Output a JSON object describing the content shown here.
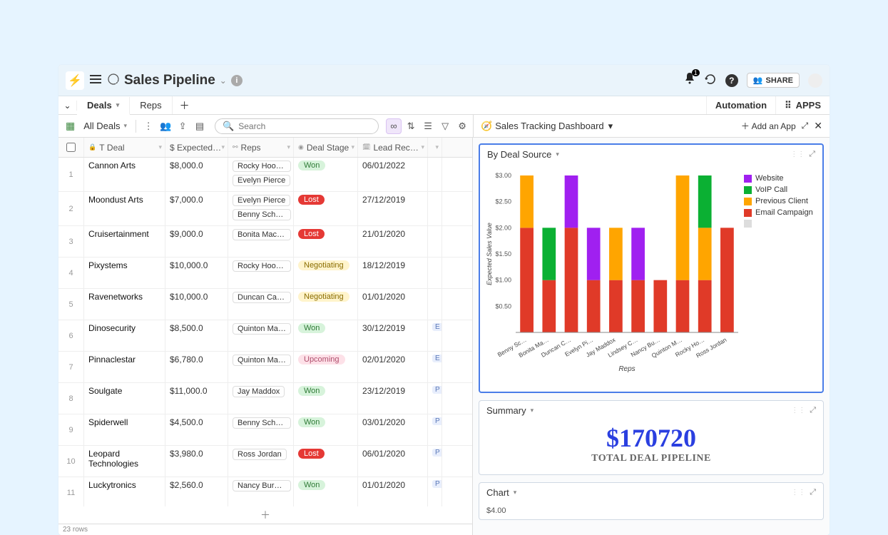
{
  "titlebar": {
    "title": "Sales Pipeline",
    "notifications": "1",
    "share": "SHARE"
  },
  "tabs": {
    "items": [
      "Deals",
      "Reps"
    ],
    "automation": "Automation",
    "apps": "APPS"
  },
  "toolbar": {
    "view_name": "All Deals",
    "search_placeholder": "Search"
  },
  "grid": {
    "headers": [
      "Deal",
      "Expected …",
      "Reps",
      "Deal Stage",
      "Lead Receive…"
    ],
    "rows": [
      {
        "n": "1",
        "deal": "Cannon Arts",
        "expected": "$8,000.0",
        "reps": [
          "Rocky Hooper",
          "Evelyn Pierce"
        ],
        "stage": "Won",
        "stage_cls": "won",
        "date": "06/01/2022",
        "src": ""
      },
      {
        "n": "2",
        "deal": "Moondust Arts",
        "expected": "$7,000.0",
        "reps": [
          "Evelyn Pierce",
          "Benny Schwartz"
        ],
        "stage": "Lost",
        "stage_cls": "lost",
        "date": "27/12/2019",
        "src": ""
      },
      {
        "n": "3",
        "deal": "Cruisertainment",
        "expected": "$9,000.0",
        "reps": [
          "Bonita Macdo…"
        ],
        "stage": "Lost",
        "stage_cls": "lost",
        "date": "21/01/2020",
        "src": ""
      },
      {
        "n": "4",
        "deal": "Pixystems",
        "expected": "$10,000.0",
        "reps": [
          "Rocky Hooper"
        ],
        "stage": "Negotiating",
        "stage_cls": "neg",
        "date": "18/12/2019",
        "src": ""
      },
      {
        "n": "5",
        "deal": "Ravenetworks",
        "expected": "$10,000.0",
        "reps": [
          "Duncan Castro"
        ],
        "stage": "Negotiating",
        "stage_cls": "neg",
        "date": "01/01/2020",
        "src": ""
      },
      {
        "n": "6",
        "deal": "Dinosecurity",
        "expected": "$8,500.0",
        "reps": [
          "Quinton Marti…"
        ],
        "stage": "Won",
        "stage_cls": "won",
        "date": "30/12/2019",
        "src": "E"
      },
      {
        "n": "7",
        "deal": "Pinnaclestar",
        "expected": "$6,780.0",
        "reps": [
          "Quinton Marti…"
        ],
        "stage": "Upcoming",
        "stage_cls": "up",
        "date": "02/01/2020",
        "src": "E"
      },
      {
        "n": "8",
        "deal": "Soulgate",
        "expected": "$11,000.0",
        "reps": [
          "Jay Maddox"
        ],
        "stage": "Won",
        "stage_cls": "won",
        "date": "23/12/2019",
        "src": "P"
      },
      {
        "n": "9",
        "deal": "Spiderwell",
        "expected": "$4,500.0",
        "reps": [
          "Benny Schwartz"
        ],
        "stage": "Won",
        "stage_cls": "won",
        "date": "03/01/2020",
        "src": "P"
      },
      {
        "n": "10",
        "deal": "Leopard Technologies",
        "expected": "$3,980.0",
        "reps": [
          "Ross Jordan"
        ],
        "stage": "Lost",
        "stage_cls": "lost",
        "date": "06/01/2020",
        "src": "P"
      },
      {
        "n": "11",
        "deal": "Luckytronics",
        "expected": "$2,560.0",
        "reps": [
          "Nancy Burnett"
        ],
        "stage": "Won",
        "stage_cls": "won",
        "date": "01/01/2020",
        "src": "P"
      }
    ],
    "row_count": "23 rows"
  },
  "dashboard": {
    "title": "Sales Tracking Dashboard",
    "add_app": "Add an App",
    "card1_title": "By Deal Source",
    "summary_title": "Summary",
    "summary_value": "$170720",
    "summary_label": "TOTAL DEAL PIPELINE",
    "chart2_title": "Chart",
    "chart2_yval": "$4.00"
  },
  "chart_data": {
    "type": "bar",
    "title": "By Deal Source",
    "ylabel": "Expected Sales Value",
    "x_label": "Reps",
    "ylim": [
      0,
      3.0
    ],
    "yticks": [
      "$0.50",
      "$1.00",
      "$1.50",
      "$2.00",
      "$2.50",
      "$3.00"
    ],
    "categories": [
      "Benny Sc…",
      "Bonita Ma…",
      "Duncan C…",
      "Evelyn Pi…",
      "Jay Maddox",
      "Lindsey C…",
      "Nancy Bu…",
      "Quinton M…",
      "Rocky Ho…",
      "Ross Jordan"
    ],
    "legend": [
      "Website",
      "VoIP Call",
      "Previous Client",
      "Email Campaign"
    ],
    "colors": {
      "Website": "#a020f0",
      "VoIP Call": "#0bb033",
      "Previous Client": "#ffa500",
      "Email Campaign": "#e03a28"
    },
    "series": [
      {
        "name": "Benny Sc…",
        "stack": [
          [
            "Email Campaign",
            2.0
          ],
          [
            "Previous Client",
            1.0
          ]
        ],
        "total": 3.0
      },
      {
        "name": "Bonita Ma…",
        "stack": [
          [
            "Email Campaign",
            1.0
          ],
          [
            "VoIP Call",
            1.0
          ]
        ],
        "total": 2.0
      },
      {
        "name": "Duncan C…",
        "stack": [
          [
            "Email Campaign",
            2.0
          ],
          [
            "Website",
            1.0
          ]
        ],
        "total": 3.0
      },
      {
        "name": "Evelyn Pi…",
        "stack": [
          [
            "Email Campaign",
            1.0
          ],
          [
            "Website",
            1.0
          ]
        ],
        "total": 2.0
      },
      {
        "name": "Jay Maddox",
        "stack": [
          [
            "Email Campaign",
            1.0
          ],
          [
            "Previous Client",
            1.0
          ]
        ],
        "total": 2.0
      },
      {
        "name": "Lindsey C…",
        "stack": [
          [
            "Email Campaign",
            1.0
          ],
          [
            "Website",
            1.0
          ]
        ],
        "total": 2.0
      },
      {
        "name": "Nancy Bu…",
        "stack": [
          [
            "Email Campaign",
            1.0
          ]
        ],
        "total": 1.0
      },
      {
        "name": "Quinton M…",
        "stack": [
          [
            "Email Campaign",
            1.0
          ],
          [
            "Previous Client",
            2.0
          ]
        ],
        "total": 3.0
      },
      {
        "name": "Rocky Ho…",
        "stack": [
          [
            "Email Campaign",
            1.0
          ],
          [
            "Previous Client",
            1.0
          ],
          [
            "VoIP Call",
            1.0
          ]
        ],
        "total": 3.0
      },
      {
        "name": "Ross Jordan",
        "stack": [
          [
            "Email Campaign",
            2.0
          ]
        ],
        "total": 2.0
      }
    ]
  }
}
